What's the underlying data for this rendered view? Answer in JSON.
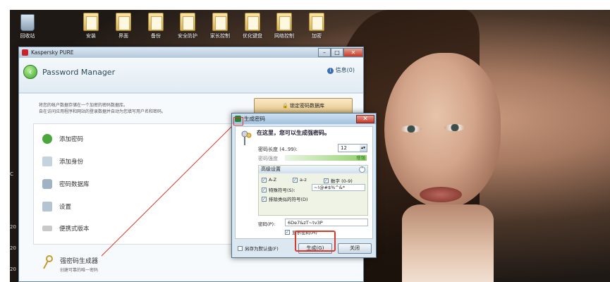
{
  "desktop": {
    "icons": [
      {
        "label": "回收站",
        "kind": "bin"
      },
      {
        "label": "安装",
        "kind": "folder"
      },
      {
        "label": "界面",
        "kind": "folder"
      },
      {
        "label": "备份",
        "kind": "folder"
      },
      {
        "label": "安全防护",
        "kind": "folder"
      },
      {
        "label": "家长控制",
        "kind": "folder"
      },
      {
        "label": "优化键盘",
        "kind": "folder"
      },
      {
        "label": "网络控制",
        "kind": "folder"
      },
      {
        "label": "加密",
        "kind": "folder"
      }
    ],
    "left_strip": [
      "C",
      "20",
      "20",
      "20"
    ]
  },
  "main_window": {
    "title": "Kaspersky PURE",
    "header": "Password Manager",
    "info_link": "信息(0)",
    "description_line1": "将您的帐户数据存储在一个加密的密码数据库。",
    "description_line2": "自在访问应用程序和网站的登录数据并自动为您填写用户名和密码。",
    "lock_button": "锁定密码数据库",
    "menu": [
      "添加密码",
      "添加身份",
      "密码数据库",
      "设置",
      "便携式版本"
    ],
    "generator_title": "强密码生成器",
    "generator_subtitle": "创建可靠的唯一密码"
  },
  "dialog": {
    "title": "生成密码",
    "heading": "在这里，您可以生成强密码。",
    "length_label": "密码长度 (4..99):",
    "length_value": "12",
    "strength_label": "密码强度",
    "strength_value": "增强",
    "advanced_label": "高级设置",
    "options": {
      "az_upper": "A-Z",
      "az_lower": "a-z",
      "digits": "数字 (0-9)",
      "special": "特殊符号(S):",
      "special_value": "~!@#$%^&*",
      "exclude_similar": "排除类似的符号(D)"
    },
    "password_label": "密码(P):",
    "password_value": "6De7&zT~tv3P",
    "show_password": "显示密码(H)",
    "save_default": "另存为默认值(F)",
    "generate_button": "生成(G)",
    "close_button": "关闭"
  },
  "colors": {
    "accent_highlight": "#d63a2a",
    "strength_green": "#2b7a1b"
  }
}
